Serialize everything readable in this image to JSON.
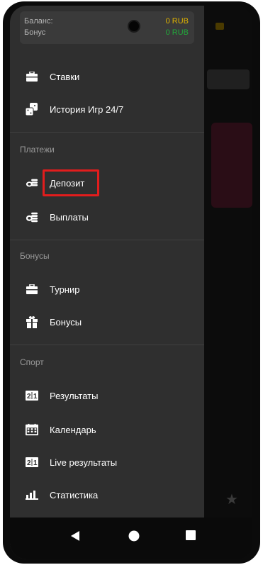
{
  "balance": {
    "balance_label": "Баланс:",
    "balance_value": "0 RUB",
    "bonus_label": "Бонус",
    "bonus_value": "0 RUB",
    "balance_color": "#e0b300",
    "bonus_color": "#22a83a"
  },
  "menu": {
    "bets": "Ставки",
    "history": "История Игр 24/7",
    "payments_section": "Платежи",
    "deposit": "Депозит",
    "payouts": "Выплаты",
    "bonuses_section": "Бонусы",
    "tournament": "Турнир",
    "bonuses": "Бонусы",
    "sport_section": "Спорт",
    "results": "Результаты",
    "calendar": "Календарь",
    "live_results": "Live результаты",
    "statistics": "Статистика"
  },
  "icons": {
    "bets": "briefcase-icon",
    "history": "dice-icon",
    "deposit": "coins-icon",
    "payouts": "coins-icon",
    "tournament": "briefcase-icon",
    "bonuses": "gift-icon",
    "results": "scoreboard-icon",
    "calendar": "calendar-icon",
    "live_results": "scoreboard-icon",
    "statistics": "bar-chart-icon"
  },
  "colors": {
    "highlight": "#e21d1d",
    "drawer_bg": "#2f2f2f"
  }
}
